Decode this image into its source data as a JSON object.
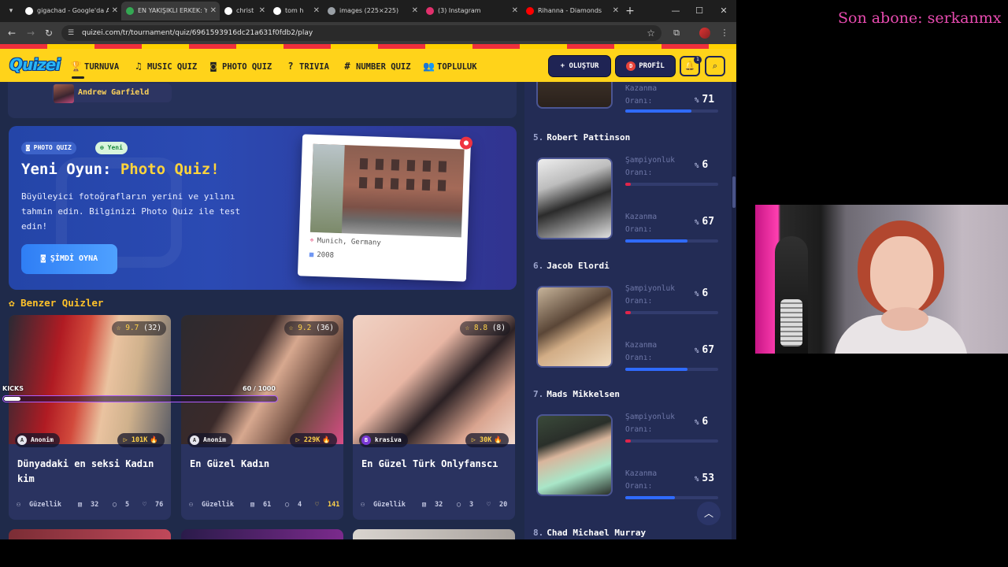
{
  "browser": {
    "tabs": [
      {
        "title": "gigachad - Google'da Ara",
        "active": false,
        "fav_color": "#ffffff"
      },
      {
        "title": "EN YAKIŞIKLI ERKEK: Y",
        "active": true,
        "fav_color": "#34a853"
      },
      {
        "title": "christ",
        "active": false,
        "fav_color": "#ffffff"
      },
      {
        "title": "tom h",
        "active": false,
        "fav_color": "#ffffff"
      },
      {
        "title": "images (225×225)",
        "active": false,
        "fav_color": "#9aa0a6"
      },
      {
        "title": "(3) Instagram",
        "active": false,
        "fav_color": "#e1306c"
      },
      {
        "title": "Rihanna - Diamonds",
        "active": false,
        "fav_color": "#ff0000"
      }
    ],
    "url": "quizei.com/tr/tournament/quiz/6961593916dc21a631f0fdb2/play"
  },
  "site": {
    "logo": "Quizei",
    "nav": [
      {
        "label": "TURNUVA",
        "icon": "trophy-icon",
        "glyph": "🏆"
      },
      {
        "label": "MUSIC QUIZ",
        "icon": "music-icon",
        "glyph": "♫"
      },
      {
        "label": "PHOTO QUIZ",
        "icon": "camera-icon",
        "glyph": "◙"
      },
      {
        "label": "TRIVIA",
        "icon": "question-icon",
        "glyph": "?"
      },
      {
        "label": "NUMBER QUIZ",
        "icon": "hash-icon",
        "glyph": "#"
      },
      {
        "label": "TOPLULUK",
        "icon": "people-icon",
        "glyph": "👥"
      }
    ],
    "create_label": "+ OLUŞTUR",
    "profile_label": "PROFİL",
    "profile_initial": "D",
    "notif_count": "1"
  },
  "previous": {
    "name": "Andrew Garfield"
  },
  "promo": {
    "badge_photo": "PHOTO QUIZ",
    "badge_new": "Yeni",
    "title_prefix": "Yeni Oyun: ",
    "title_highlight": "Photo Quiz!",
    "desc": "Büyüleyici fotoğrafların yerini ve yılını tahmin edin. Bilginizi Photo Quiz ile test edin!",
    "play_label": "ŞİMDİ OYNA",
    "location": "Munich, Germany",
    "year": "2008"
  },
  "similar": {
    "title": "Benzer Quizler",
    "cards": [
      {
        "rating": "9.7",
        "votes": "(32)",
        "author": "Anonim",
        "author_initial": "A",
        "plays": "101K",
        "title": "Dünyadaki en seksi Kadın kim",
        "category": "Güzellik",
        "questions": "32",
        "comments": "5",
        "likes": "76",
        "liked": false
      },
      {
        "rating": "9.2",
        "votes": "(36)",
        "author": "Anonim",
        "author_initial": "A",
        "plays": "229K",
        "title": "En Güzel Kadın",
        "category": "Güzellik",
        "questions": "61",
        "comments": "4",
        "likes": "141",
        "liked": true
      },
      {
        "rating": "8.8",
        "votes": "(8)",
        "author": "krasiva",
        "author_initial": "B",
        "plays": "30K",
        "title": "En Güzel Türk Onlyfanscı",
        "category": "Güzellik",
        "questions": "32",
        "comments": "3",
        "likes": "20",
        "liked": false
      }
    ]
  },
  "overlay": {
    "kicks_label": "KICKS",
    "progress_text": "60 / 1000",
    "progress_fraction": 0.06,
    "last_sub": "Son abone: serkanmx"
  },
  "ranking": {
    "champ_label": "Şampiyonluk Oranı:",
    "win_label": "Kazanma Oranı:",
    "pct": "%",
    "top_partial": {
      "win_rate": "71"
    },
    "items": [
      {
        "rank": "5.",
        "name": "Robert Pattinson",
        "champ": "6",
        "win": "67"
      },
      {
        "rank": "6.",
        "name": "Jacob Elordi",
        "champ": "6",
        "win": "67"
      },
      {
        "rank": "7.",
        "name": "Mads Mikkelsen",
        "champ": "6",
        "win": "53"
      },
      {
        "rank": "8.",
        "name": "Chad Michael Murray",
        "champ": "",
        "win": ""
      }
    ],
    "colors": {
      "champ_bar": "#e0244a",
      "win_bar": "#2f6bff"
    }
  }
}
